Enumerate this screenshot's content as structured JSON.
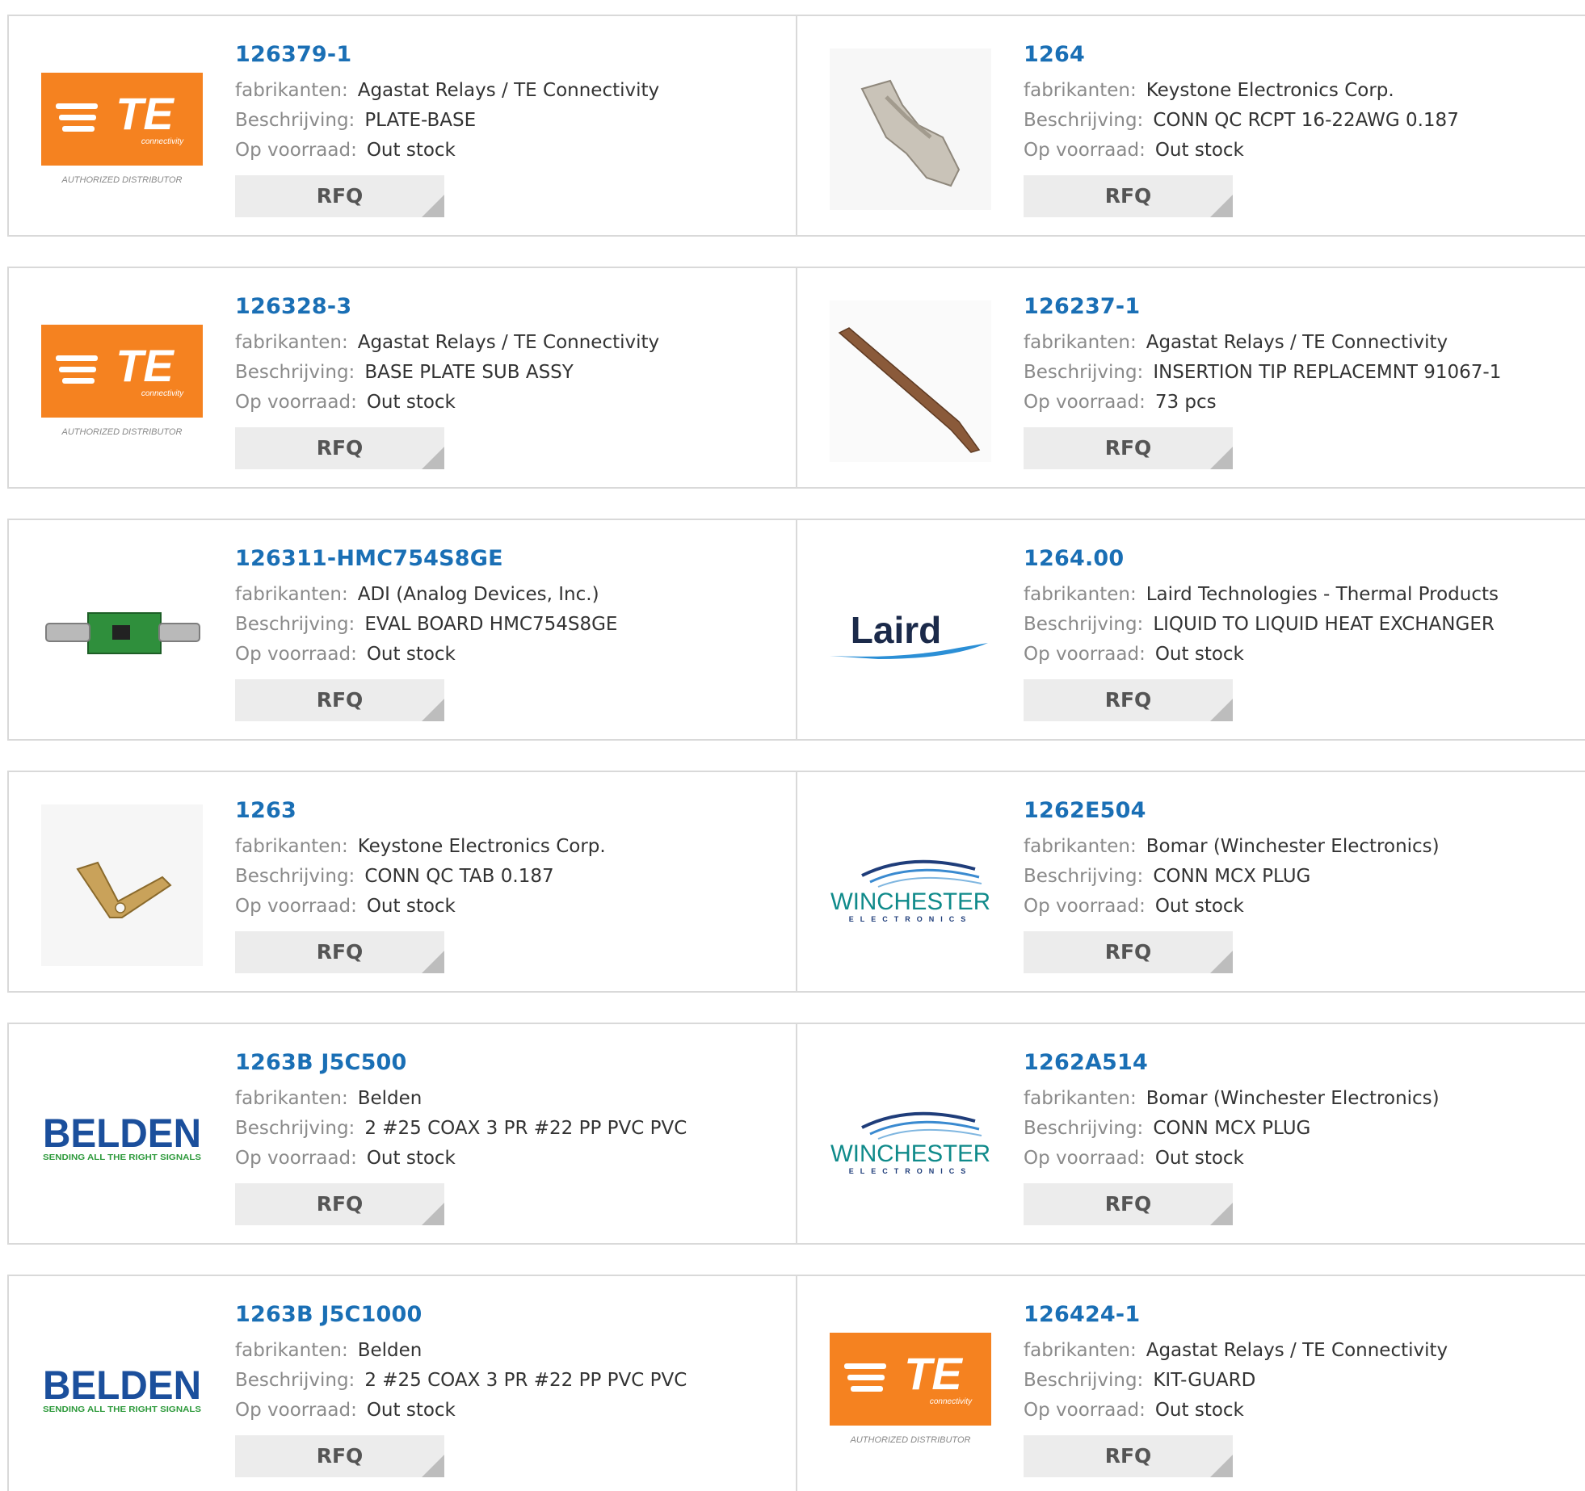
{
  "labels": {
    "manufacturer": "fabrikanten:",
    "description": "Beschrijving:",
    "stock": "Op voorraad:",
    "rfq": "RFQ"
  },
  "products": [
    {
      "part": "126379-1",
      "manufacturer": "Agastat Relays / TE Connectivity",
      "description": "PLATE-BASE",
      "stock": "Out stock",
      "image": "te-connectivity-logo",
      "logo_text": "TE",
      "logo_sub": "connectivity",
      "logo_caption": "AUTHORIZED DISTRIBUTOR"
    },
    {
      "part": "1264",
      "manufacturer": "Keystone Electronics Corp.",
      "description": "CONN QC RCPT 16-22AWG 0.187",
      "stock": "Out stock",
      "image": "quick-connect-receptacle-photo"
    },
    {
      "part": "126328-3",
      "manufacturer": "Agastat Relays / TE Connectivity",
      "description": "BASE PLATE SUB ASSY",
      "stock": "Out stock",
      "image": "te-connectivity-logo",
      "logo_text": "TE",
      "logo_sub": "connectivity",
      "logo_caption": "AUTHORIZED DISTRIBUTOR"
    },
    {
      "part": "126237-1",
      "manufacturer": "Agastat Relays / TE Connectivity",
      "description": "INSERTION TIP REPLACEMNT 91067-1",
      "stock": "73 pcs",
      "image": "insertion-tip-photo"
    },
    {
      "part": "126311-HMC754S8GE",
      "manufacturer": "ADI (Analog Devices, Inc.)",
      "description": "EVAL BOARD HMC754S8GE",
      "stock": "Out stock",
      "image": "eval-board-photo"
    },
    {
      "part": "1264.00",
      "manufacturer": "Laird Technologies - Thermal Products",
      "description": "LIQUID TO LIQUID HEAT EXCHANGER",
      "stock": "Out stock",
      "image": "laird-logo",
      "logo_text": "Laird"
    },
    {
      "part": "1263",
      "manufacturer": "Keystone Electronics Corp.",
      "description": "CONN QC TAB 0.187",
      "stock": "Out stock",
      "image": "quick-connect-tab-photo"
    },
    {
      "part": "1262E504",
      "manufacturer": "Bomar (Winchester Electronics)",
      "description": "CONN MCX PLUG",
      "stock": "Out stock",
      "image": "winchester-logo",
      "logo_text": "WINCHESTER",
      "logo_sub": "ELECTRONICS"
    },
    {
      "part": "1263B J5C500",
      "manufacturer": "Belden",
      "description": "2 #25 COAX 3 PR #22 PP PVC PVC",
      "stock": "Out stock",
      "image": "belden-logo",
      "logo_text": "BELDEN",
      "logo_sub": "SENDING ALL THE RIGHT SIGNALS"
    },
    {
      "part": "1262A514",
      "manufacturer": "Bomar (Winchester Electronics)",
      "description": "CONN MCX PLUG",
      "stock": "Out stock",
      "image": "winchester-logo",
      "logo_text": "WINCHESTER",
      "logo_sub": "ELECTRONICS"
    },
    {
      "part": "1263B J5C1000",
      "manufacturer": "Belden",
      "description": "2 #25 COAX 3 PR #22 PP PVC PVC",
      "stock": "Out stock",
      "image": "belden-logo",
      "logo_text": "BELDEN",
      "logo_sub": "SENDING ALL THE RIGHT SIGNALS"
    },
    {
      "part": "126424-1",
      "manufacturer": "Agastat Relays / TE Connectivity",
      "description": "KIT-GUARD",
      "stock": "Out stock",
      "image": "te-connectivity-logo",
      "logo_text": "TE",
      "logo_sub": "connectivity",
      "logo_caption": "AUTHORIZED DISTRIBUTOR"
    }
  ],
  "colors": {
    "part_link": "#1a6fb5",
    "te_orange": "#f58220",
    "belden_blue": "#1b4f9c",
    "belden_green": "#2e9a3c",
    "winchester_teal": "#0f8a8a",
    "winchester_navy": "#1f3d7a",
    "laird_navy": "#1b2a4a",
    "laird_blue": "#2b8fd6",
    "rfq_bg": "#ececec"
  }
}
